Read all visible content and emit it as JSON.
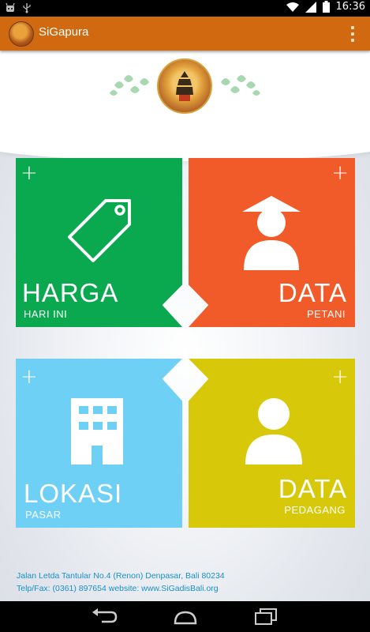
{
  "status_bar": {
    "time": "16:36",
    "icons": [
      "android-notification-icon",
      "usb-icon",
      "wifi-icon",
      "signal-icon",
      "battery-icon"
    ]
  },
  "action_bar": {
    "title": "SiGapura",
    "overflow_icon": "overflow-menu-icon"
  },
  "tiles": [
    {
      "title": "HARGA",
      "subtitle": "HARI INI",
      "icon": "price-tag-icon",
      "color": "#0aa84f"
    },
    {
      "title": "DATA",
      "subtitle": "PETANI",
      "icon": "farmer-icon",
      "color": "#f15b2a"
    },
    {
      "title": "LOKASI",
      "subtitle": "PASAR",
      "icon": "building-icon",
      "color": "#6fd0f6"
    },
    {
      "title": "DATA",
      "subtitle": "PEDAGANG",
      "icon": "trader-icon",
      "color": "#d7c90a"
    }
  ],
  "plus_label": "+",
  "footer": {
    "address": "Jalan Letda Tantular No.4 (Renon) Denpasar, Bali 80234",
    "contact": "Telp/Fax: (0361) 897654  website: www.SiGadisBali.org"
  },
  "nav_bar": {
    "icons": [
      "back-icon",
      "home-icon",
      "recent-apps-icon"
    ]
  }
}
